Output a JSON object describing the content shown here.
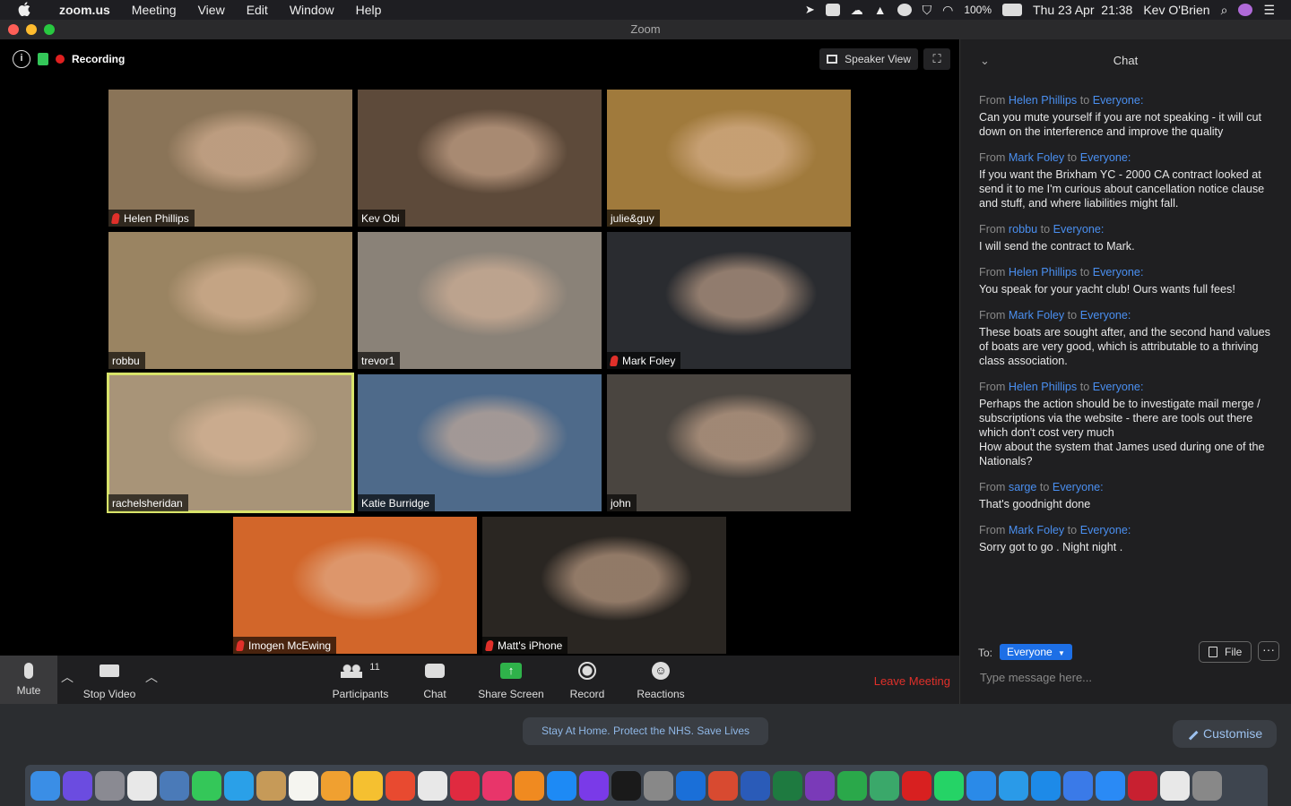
{
  "menubar": {
    "app_name": "zoom.us",
    "menus": [
      "Meeting",
      "View",
      "Edit",
      "Window",
      "Help"
    ],
    "battery": "100%",
    "datetime": "Thu 23 Apr  21:38",
    "user": "Kev O'Brien"
  },
  "window": {
    "title": "Zoom"
  },
  "meeting": {
    "recording_label": "Recording",
    "view_button": "Speaker View",
    "participants": [
      {
        "name": "Helen Phillips",
        "muted": true,
        "bg": "#8a7458"
      },
      {
        "name": "Kev Obi",
        "muted": false,
        "bg": "#5d4a3a"
      },
      {
        "name": "julie&guy",
        "muted": false,
        "bg": "#a07a3c"
      },
      {
        "name": "robbu",
        "muted": false,
        "bg": "#9a8462"
      },
      {
        "name": "trevor1",
        "muted": false,
        "bg": "#8a8278"
      },
      {
        "name": "Mark Foley",
        "muted": true,
        "bg": "#2a2c30"
      },
      {
        "name": "rachelsheridan",
        "muted": false,
        "bg": "#a89478",
        "active": true
      },
      {
        "name": "Katie Burridge",
        "muted": false,
        "bg": "#4e6a8a"
      },
      {
        "name": "john",
        "muted": false,
        "bg": "#4a4540"
      },
      {
        "name": "Imogen McEwing",
        "muted": true,
        "bg": "#d2662a"
      },
      {
        "name": "Matt's iPhone",
        "muted": true,
        "bg": "#2a2622"
      }
    ]
  },
  "toolbar": {
    "mute": "Mute",
    "stop_video": "Stop Video",
    "participants": "Participants",
    "participant_count": "11",
    "chat": "Chat",
    "share_screen": "Share Screen",
    "record": "Record",
    "reactions": "Reactions",
    "leave": "Leave Meeting"
  },
  "chat": {
    "title": "Chat",
    "messages": [
      {
        "sender": "Helen Phillips",
        "to": "Everyone",
        "text": "Can you mute yourself if you are not speaking - it will cut down on the interference and improve the quality"
      },
      {
        "sender": "Mark Foley",
        "to": "Everyone",
        "text": "If you want the Brixham YC - 2000 CA contract looked at send it to me I'm curious about cancellation notice clause and stuff, and where liabilities might fall."
      },
      {
        "sender": "robbu",
        "to": "Everyone",
        "text": "I will send the contract to Mark."
      },
      {
        "sender": "Helen Phillips",
        "to": "Everyone",
        "text": "You speak for your yacht club!  Ours wants full fees!"
      },
      {
        "sender": "Mark Foley",
        "to": "Everyone",
        "text": "These boats are sought after, and the second hand values of boats are very good, which is attributable to a thriving class association."
      },
      {
        "sender": "Helen Phillips",
        "to": "Everyone",
        "text": "Perhaps the action should be to investigate mail merge / subscriptions via the website - there are tools out there which don't cost very much\nHow about the system that James used during one of the Nationals?"
      },
      {
        "sender": "sarge",
        "to": "Everyone",
        "text": "That's goodnight done"
      },
      {
        "sender": "Mark Foley",
        "to": "Everyone",
        "text": "Sorry got to go . Night night ."
      }
    ],
    "from_word": "From",
    "to_word": "to",
    "to_label": "To:",
    "recipient": "Everyone",
    "file_button": "File",
    "input_placeholder": "Type message here..."
  },
  "banner": "Stay At Home. Protect the NHS. Save Lives",
  "customise": "Customise",
  "dock_colors": [
    "#3a8ee6",
    "#6b4ce0",
    "#8a8a92",
    "#e8e8e8",
    "#4a7ab8",
    "#34c759",
    "#2aa0e8",
    "#c69a58",
    "#f5f5f0",
    "#f0a030",
    "#f5c030",
    "#e84a30",
    "#e8e8e8",
    "#e02a40",
    "#e8356a",
    "#f08a20",
    "#1d8af5",
    "#7a3ae8",
    "#1a1a1a",
    "#888",
    "#1a6fd8",
    "#d84a30",
    "#2a5bb8",
    "#1e7a40",
    "#7a3ab8",
    "#2aa84a",
    "#3aa86a",
    "#d82020",
    "#25d366",
    "#2a8ae8",
    "#2a9ae8",
    "#1d8ae8",
    "#3a7ae8",
    "#2a8af5",
    "#c82030",
    "#e8e8e8",
    "#888"
  ]
}
